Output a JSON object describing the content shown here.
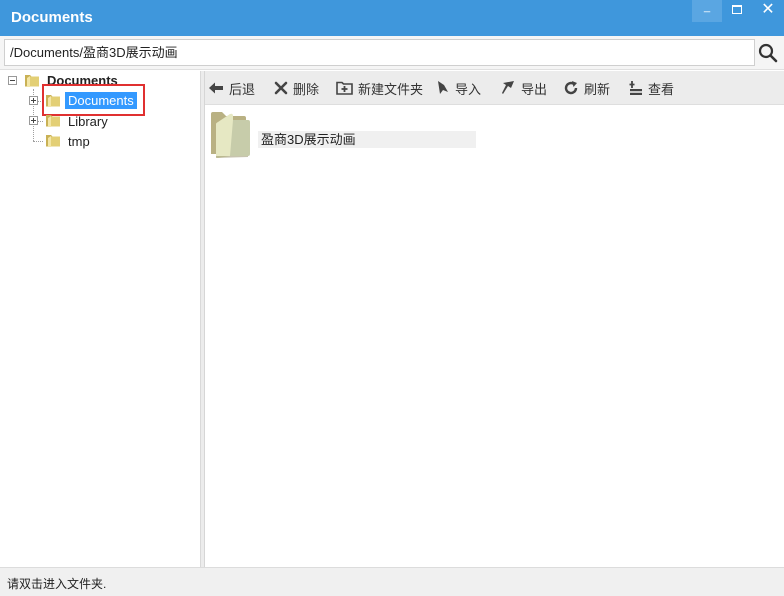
{
  "window": {
    "title": "Documents",
    "min_glyph": "_",
    "close_glyph": "✕"
  },
  "pathbar": {
    "path": "/Documents/盈商3D展示动画"
  },
  "tree": {
    "root": {
      "label": "Documents",
      "expanded": true
    },
    "children": [
      {
        "label": "Documents",
        "selected": true,
        "has_children": true
      },
      {
        "label": "Library",
        "selected": false,
        "has_children": true
      },
      {
        "label": "tmp",
        "selected": false,
        "has_children": false
      }
    ]
  },
  "toolbar": {
    "back_label": "后退",
    "delete_label": "删除",
    "new_folder_label": "新建文件夹",
    "import_label": "导入",
    "export_label": "导出",
    "refresh_label": "刷新",
    "view_label": "查看"
  },
  "content": {
    "items": [
      {
        "name": "盈商3D展示动画",
        "type": "folder"
      }
    ]
  },
  "status": {
    "text": "请双击进入文件夹."
  },
  "colors": {
    "titlebar": "#3f97dc",
    "selection": "#3399ff",
    "highlight_box": "#e03030",
    "folder": "#d9c46a"
  }
}
